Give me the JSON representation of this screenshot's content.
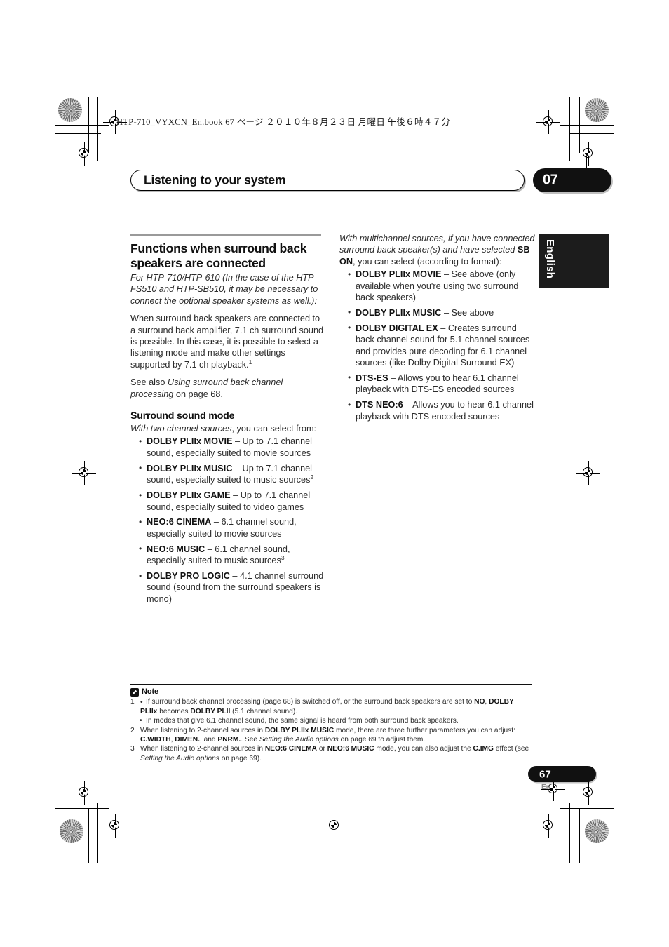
{
  "file_header": "HTP-710_VYXCN_En.book   67 ページ   ２０１０年８月２３日   月曜日   午後６時４７分",
  "chapter": {
    "title": "Listening to your system",
    "number": "07"
  },
  "language_tab": "English",
  "left_column": {
    "section_title": "Functions when surround back speakers are connected",
    "intro_italic": "For HTP-710/HTP-610 (In the case of the HTP-FS510 and HTP-SB510, it may be necessary to connect the optional speaker systems as well.):",
    "paragraph_1": "When surround back speakers are connected to a surround back amplifier, 7.1 ch surround sound is possible. In this case, it is possible to select a listening mode and make other settings supported by 7.1 ch playback.",
    "paragraph_1_footnote": "1",
    "see_also_prefix": "See also ",
    "see_also_italic": "Using surround back channel processing",
    "see_also_suffix": " on page 68.",
    "subsection_title": "Surround sound mode",
    "two_channel_lead_italic": "With two channel sources",
    "two_channel_lead_rest": ", you can select from:",
    "bullets": [
      {
        "term": "DOLBY PLIIx MOVIE",
        "description": " – Up to 7.1 channel sound, especially suited to movie sources",
        "footnote": ""
      },
      {
        "term": "DOLBY PLIIx MUSIC",
        "description": " – Up to 7.1 channel sound, especially suited to music sources",
        "footnote": "2"
      },
      {
        "term": "DOLBY PLIIx GAME",
        "description": " – Up to 7.1 channel sound, especially suited to video games",
        "footnote": ""
      },
      {
        "term": "NEO:6 CINEMA",
        "description": " – 6.1 channel sound, especially suited to movie sources",
        "footnote": ""
      },
      {
        "term": "NEO:6 MUSIC",
        "description": " – 6.1 channel sound, especially suited to music sources",
        "footnote": "3"
      },
      {
        "term": "DOLBY PRO LOGIC",
        "description": " – 4.1 channel surround sound (sound from the surround speakers is mono)",
        "footnote": ""
      }
    ]
  },
  "right_column": {
    "lead_italic_1": "With multichannel sources, if you have connected surround back speaker(s) and have selected ",
    "lead_bold": "SB ON",
    "lead_rest": ", you can select (according to format):",
    "bullets": [
      {
        "term": "DOLBY PLIIx MOVIE",
        "description": " – See above (only available when you're using two surround back speakers)"
      },
      {
        "term": "DOLBY PLIIx MUSIC",
        "description": " – See above"
      },
      {
        "term": "DOLBY DIGITAL EX",
        "description": " – Creates surround back channel sound for 5.1 channel sources and provides pure decoding for 6.1 channel sources (like Dolby Digital Surround EX)"
      },
      {
        "term": "DTS-ES",
        "description": " – Allows you to hear 6.1 channel playback with DTS-ES encoded sources"
      },
      {
        "term": "DTS NEO:6",
        "description": " – Allows you to hear 6.1 channel playback with DTS encoded sources"
      }
    ]
  },
  "notes": {
    "heading": "Note",
    "icon": "note-pencil-icon",
    "note1": {
      "num": "1",
      "part1": "If surround back channel processing (page 68) is switched off, or the surround back speakers are set to ",
      "bold1": "NO",
      "part2": ", ",
      "bold2": "DOLBY PLIIx",
      "part3": " becomes ",
      "bold3": "DOLBY PLII",
      "part4": " (5.1 channel sound).",
      "sub": "In modes that give 6.1 channel sound, the same signal is heard from both surround back speakers."
    },
    "note2": {
      "num": "2",
      "part1": "When listening to 2-channel sources in ",
      "bold1": "DOLBY PLIIx MUSIC",
      "part2": " mode, there are three further parameters you can adjust: ",
      "bold2": "C.WIDTH",
      "part3": ", ",
      "bold3": "DIMEN.",
      "part4": ", and ",
      "bold4": "PNRM.",
      "part5": ". See ",
      "italic1": "Setting the Audio options",
      "part6": " on page 69 to adjust them."
    },
    "note3": {
      "num": "3",
      "part1": "When listening to 2-channel sources in ",
      "bold1": "NEO:6 CINEMA",
      "part2": " or ",
      "bold2": "NEO:6 MUSIC",
      "part3": " mode, you can also adjust the ",
      "bold3": "C.IMG",
      "part4": " effect (see ",
      "italic1": "Setting the Audio options",
      "part5": " on page 69)."
    }
  },
  "footer": {
    "page_number": "67",
    "page_language": "En"
  },
  "colors": {
    "ink": "#1a1a1a",
    "body_text": "#2b2b2b",
    "accent_black": "#111111",
    "rule_gray": "#9a9a9a"
  }
}
